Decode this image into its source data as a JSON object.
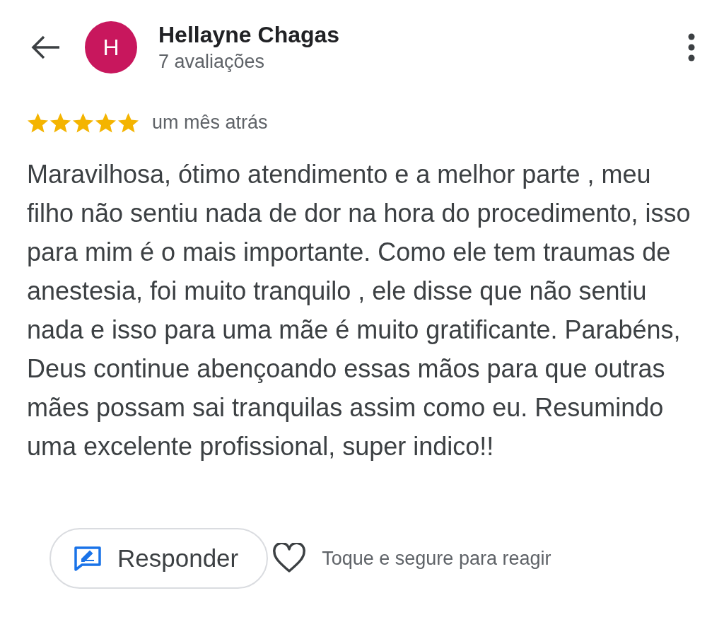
{
  "header": {
    "avatar_letter": "H",
    "name": "Hellayne Chagas",
    "subtitle": "7 avaliações"
  },
  "review": {
    "stars": 5,
    "time": "um mês atrás",
    "text": "Maravilhosa, ótimo atendimento e a melhor parte , meu filho não sentiu nada de dor na hora do procedimento, isso para mim é o mais importante. Como ele tem traumas de anestesia, foi muito tranquilo , ele disse que não sentiu nada e isso para uma mãe é muito gratificante. Parabéns, Deus continue abençoando essas mãos para que outras mães possam sai tranquilas assim como eu. Resumindo uma excelente profissional, super indico!!"
  },
  "actions": {
    "reply_button": "Responder",
    "react_hint": "Toque e segure para reagir"
  }
}
